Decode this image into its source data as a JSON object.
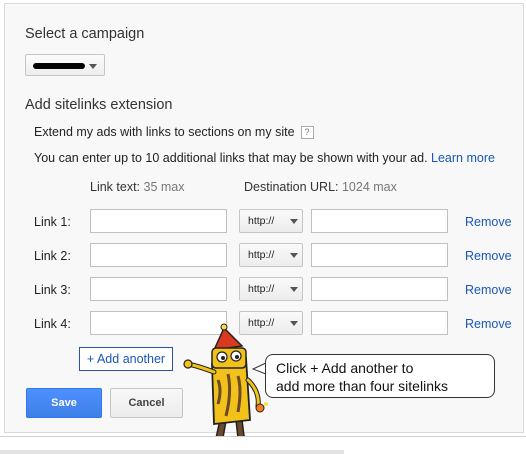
{
  "campaign": {
    "title": "Select a campaign",
    "selected_value_redacted": true
  },
  "sitelinks": {
    "title": "Add sitelinks extension",
    "extend_text": "Extend my ads with links to sections on my site",
    "help_glyph": "?",
    "info_text": "You can enter up to 10 additional links that may be shown with your ad.",
    "learn_more": "Learn more",
    "columns": {
      "link_text_label": "Link text:",
      "link_text_max": "35 max",
      "dest_url_label": "Destination URL:",
      "dest_url_max": "1024 max"
    },
    "rows": [
      {
        "label": "Link 1:",
        "link_text": "",
        "protocol": "http://",
        "url": "",
        "remove": "Remove"
      },
      {
        "label": "Link 2:",
        "link_text": "",
        "protocol": "http://",
        "url": "",
        "remove": "Remove"
      },
      {
        "label": "Link 3:",
        "link_text": "",
        "protocol": "http://",
        "url": "",
        "remove": "Remove"
      },
      {
        "label": "Link 4:",
        "link_text": "",
        "protocol": "http://",
        "url": "",
        "remove": "Remove"
      }
    ],
    "add_another": "+ Add another"
  },
  "actions": {
    "save": "Save",
    "cancel": "Cancel"
  },
  "callout": {
    "line1": "Click + Add another to",
    "line2": "add more than four sitelinks"
  },
  "colors": {
    "panel_bg": "#f7f8f7",
    "link": "#1a57b8",
    "save_button": "#4d90fe",
    "mascot_body": "#f2c21b",
    "mascot_hat": "#d93a1f"
  },
  "icons": {
    "dropdown": "chevron-down-icon",
    "help": "help-icon",
    "mascot": "pencil-mascot-icon"
  }
}
